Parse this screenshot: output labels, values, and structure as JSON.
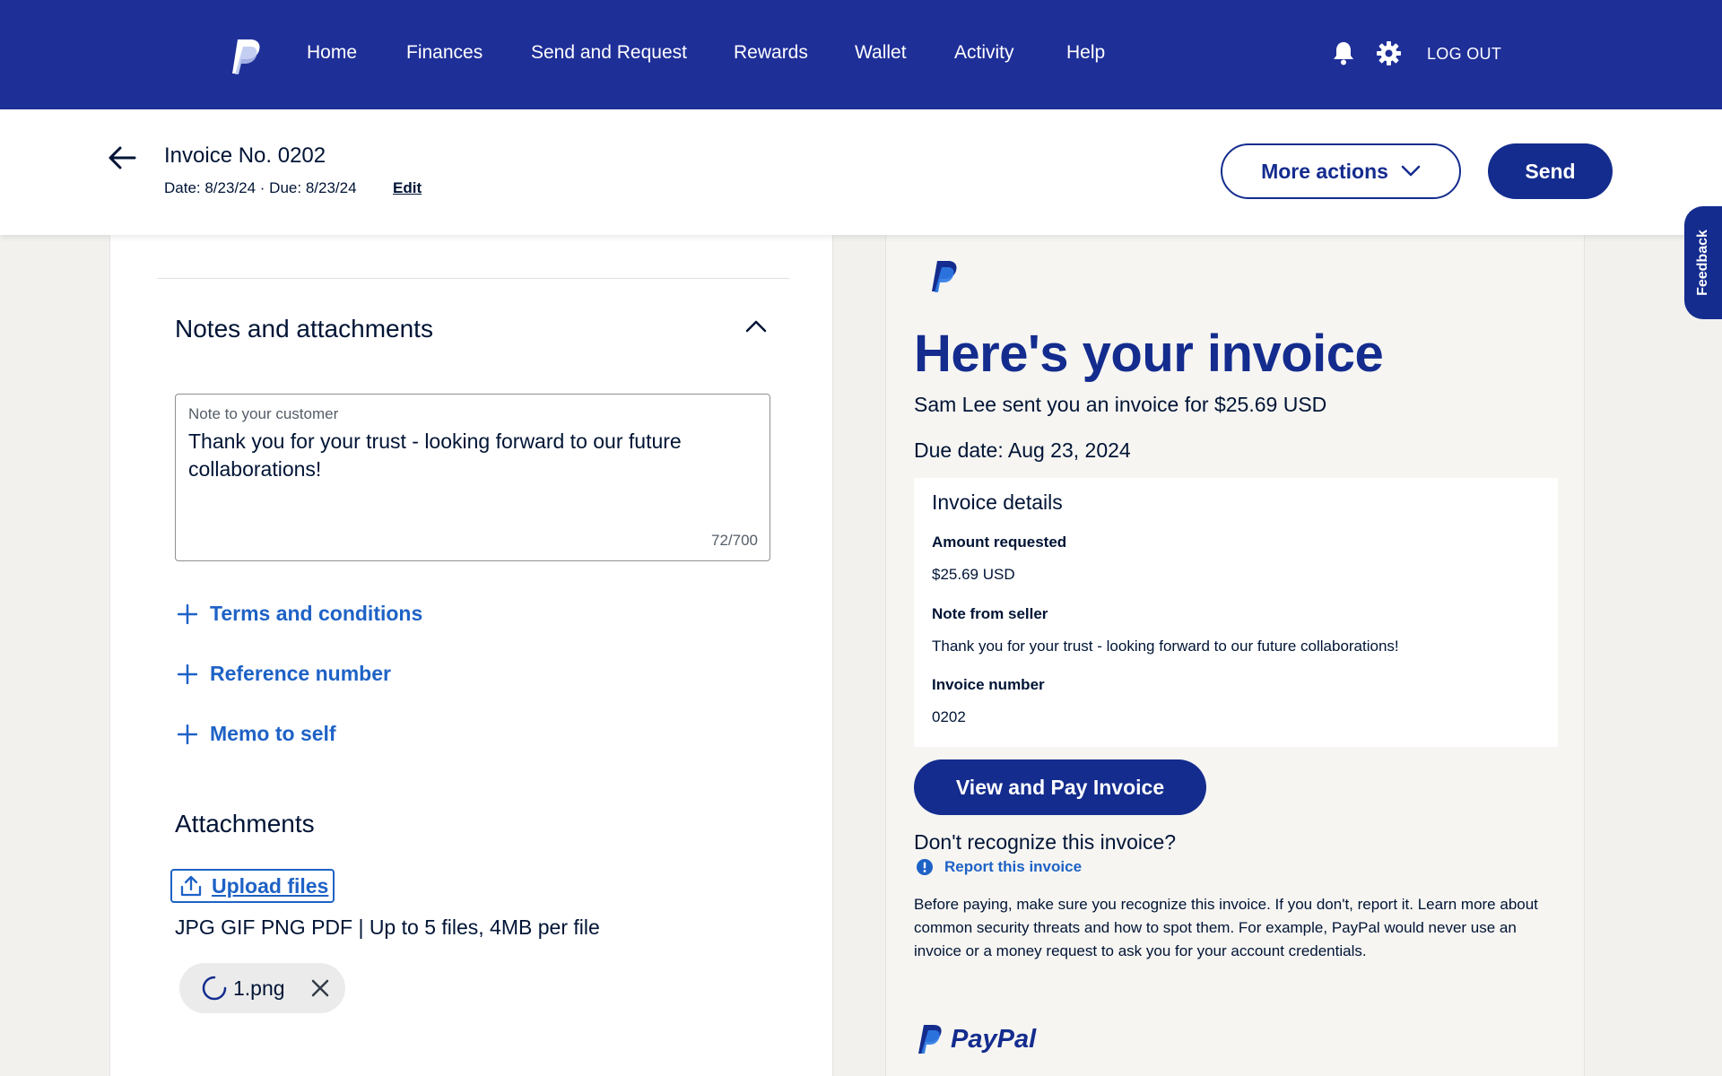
{
  "nav": {
    "items": [
      "Home",
      "Finances",
      "Send and Request",
      "Rewards",
      "Wallet",
      "Activity",
      "Help"
    ],
    "logout": "LOG OUT"
  },
  "header": {
    "title": "Invoice No. 0202",
    "dates": "Date: 8/23/24 · Due: 8/23/24",
    "edit": "Edit",
    "more_actions": "More actions",
    "send": "Send"
  },
  "feedback": "Feedback",
  "notes": {
    "section_title": "Notes and attachments",
    "note_label": "Note to your customer",
    "note_value": "Thank you for your trust - looking forward to our future collaborations!",
    "note_count": "72/700",
    "links": [
      "Terms and conditions",
      "Reference number",
      "Memo to self"
    ],
    "attachments_title": "Attachments",
    "upload": "Upload files",
    "file_hint": "JPG GIF PNG PDF | Up to 5 files, 4MB per file",
    "file_name": "1.png"
  },
  "preview": {
    "heading": "Here's your invoice",
    "sent": "Sam Lee sent you an invoice for $25.69 USD",
    "due": "Due date: Aug 23, 2024",
    "details_title": "Invoice details",
    "amount_label": "Amount requested",
    "amount_value": "$25.69 USD",
    "note_label": "Note from seller",
    "note_value": "Thank you for your trust - looking forward to our future collaborations!",
    "number_label": "Invoice number",
    "number_value": "0202",
    "pay_button": "View and Pay Invoice",
    "question": "Don't recognize this invoice?",
    "report": "Report this invoice",
    "warning": "Before paying, make sure you recognize this invoice. If you don't, report it. Learn more about common security threats and how to spot them. For example, PayPal would never use an invoice or a money request to ask you for your account credentials.",
    "brand": "PayPal"
  },
  "colors": {
    "nav_bg": "#1f2f98",
    "primary": "#142c8e",
    "link": "#1e62c6"
  }
}
